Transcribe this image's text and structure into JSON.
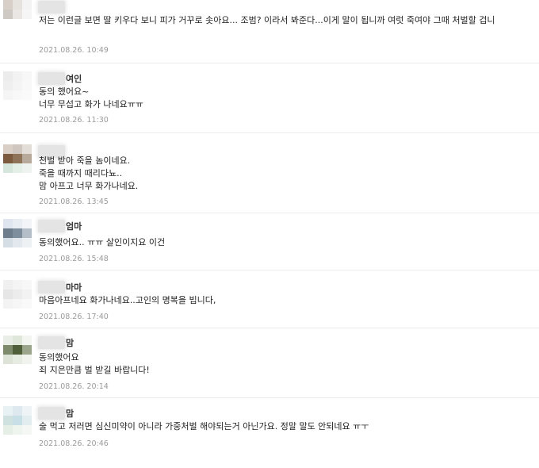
{
  "comments": [
    {
      "nickname": "",
      "text": "저는 이런글 보면 딸 키우다 보니 피가 거꾸로 솟아요... 조범? 이라서 봐준다...이게 말이 됩니까 여럿 죽여야 그때 처벌할 겁니",
      "date": "2021.08.26. 10:49",
      "avatar_colors": [
        "#d8cfc8",
        "#e6e2de",
        "#f3f3f3",
        "#cfc9c4",
        "#e9e6e3",
        "#f5f5f5",
        "#ffffff",
        "#ffffff",
        "#ffffff"
      ]
    },
    {
      "nickname": "여인",
      "text": "동의 했어요~\n너무 무섭고 화가 나네요ㅠㅠ",
      "date": "2021.08.26. 11:30",
      "avatar_colors": [
        "#ececec",
        "#f2f2f2",
        "#f7f7f7",
        "#efefef",
        "#f4f4f4",
        "#f8f8f8",
        "#f5f5f5",
        "#f8f8f8",
        "#fafafa"
      ]
    },
    {
      "nickname": "",
      "text": "천벌 받아 죽을 놈이네요.\n죽을 때까지 때리다뇨..\n맘 아프고 너무 화가나네요.",
      "date": "2021.08.26. 13:45",
      "avatar_colors": [
        "#d9cfc6",
        "#cfc6bf",
        "#e3ddd8",
        "#7b5a3e",
        "#8e7358",
        "#b8aa9a",
        "#d6e6dc",
        "#e4efe8",
        "#eef3ef"
      ]
    },
    {
      "nickname": "엄마",
      "text": "동의했어요.. ㅠㅠ 살인이지요 이건",
      "date": "2021.08.26. 15:48",
      "avatar_colors": [
        "#dfe6ef",
        "#e8edf3",
        "#f2f4f7",
        "#6d7d8c",
        "#7f8e9c",
        "#b4bec8",
        "#d5dde5",
        "#e3e8ee",
        "#eef1f4"
      ]
    },
    {
      "nickname": "마마",
      "text": "마음아프네요 화가나네요..고인의 명복을 빕니다,",
      "date": "2021.08.26. 17:40",
      "avatar_colors": [
        "#f0f0f0",
        "#f4f4f4",
        "#f7f7f7",
        "#e6e6e6",
        "#ececec",
        "#f2f2f2",
        "#f3f3f3",
        "#f6f6f6",
        "#f9f9f9"
      ]
    },
    {
      "nickname": "맘",
      "text": "동의했어요\n죄 지은만큼 벌 받길 바랍니다!",
      "date": "2021.08.26. 20:14",
      "avatar_colors": [
        "#e9eee6",
        "#dfe7da",
        "#f3f5f1",
        "#7d8a6c",
        "#4f5f3a",
        "#9aa58c",
        "#dde3d6",
        "#e7ece2",
        "#f1f3ee"
      ]
    },
    {
      "nickname": "맘",
      "text": "술 먹고 저러면 심신미약이 아니라 가중처벌 해야되는거 아닌가요. 정말 말도 안되네요 ㅠㅜ",
      "date": "2021.08.26. 20:46",
      "avatar_colors": [
        "#e8f1f3",
        "#dde9ee",
        "#eef4f5",
        "#cfe2e0",
        "#c9dfe8",
        "#e2edef",
        "#e6efe6",
        "#eef4ee",
        "#f4f7f4"
      ]
    }
  ]
}
